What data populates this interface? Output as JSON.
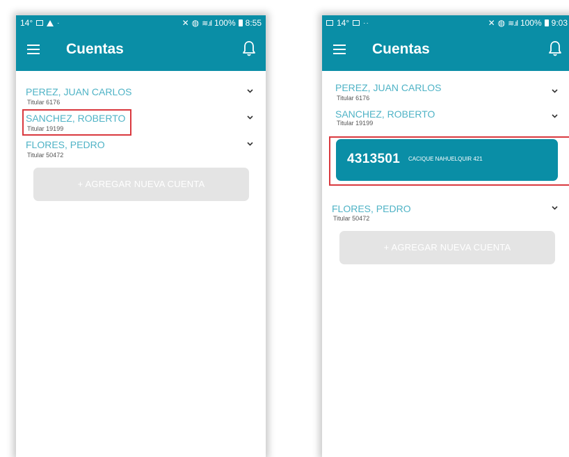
{
  "left_screen": {
    "status": {
      "temp": "14°",
      "battery": "100%",
      "time": "8:55"
    },
    "title": "Cuentas",
    "accounts": [
      {
        "name": "PEREZ, JUAN CARLOS",
        "subtitle": "Titular 6176"
      },
      {
        "name": "SANCHEZ, ROBERTO",
        "subtitle": "Titular 19199"
      },
      {
        "name": "FLORES, PEDRO",
        "subtitle": "Titular 50472"
      }
    ],
    "add_button": "+ AGREGAR NUEVA CUENTA"
  },
  "right_screen": {
    "status": {
      "temp": "14°",
      "battery": "100%",
      "time": "9:03"
    },
    "title": "Cuentas",
    "accounts": [
      {
        "name": "PEREZ, JUAN CARLOS",
        "subtitle": "Titular 6176"
      },
      {
        "name": "SANCHEZ, ROBERTO",
        "subtitle": "Titular 19199"
      },
      {
        "name": "FLORES, PEDRO",
        "subtitle": "Titular 50472"
      }
    ],
    "expanded_card": {
      "number": "4313501",
      "address": "CACIQUE NAHUELQUIR 421"
    },
    "add_button": "+ AGREGAR NUEVA CUENTA"
  },
  "colors": {
    "primary": "#0a8ea6",
    "account_name": "#4fb3c6",
    "highlight": "#d9383e",
    "button_bg": "#e4e4e4"
  },
  "icons": [
    "menu-icon",
    "bell-icon",
    "chevron-down-icon",
    "mute-icon",
    "alarm-icon",
    "wifi-icon",
    "signal-icon",
    "battery-icon"
  ]
}
